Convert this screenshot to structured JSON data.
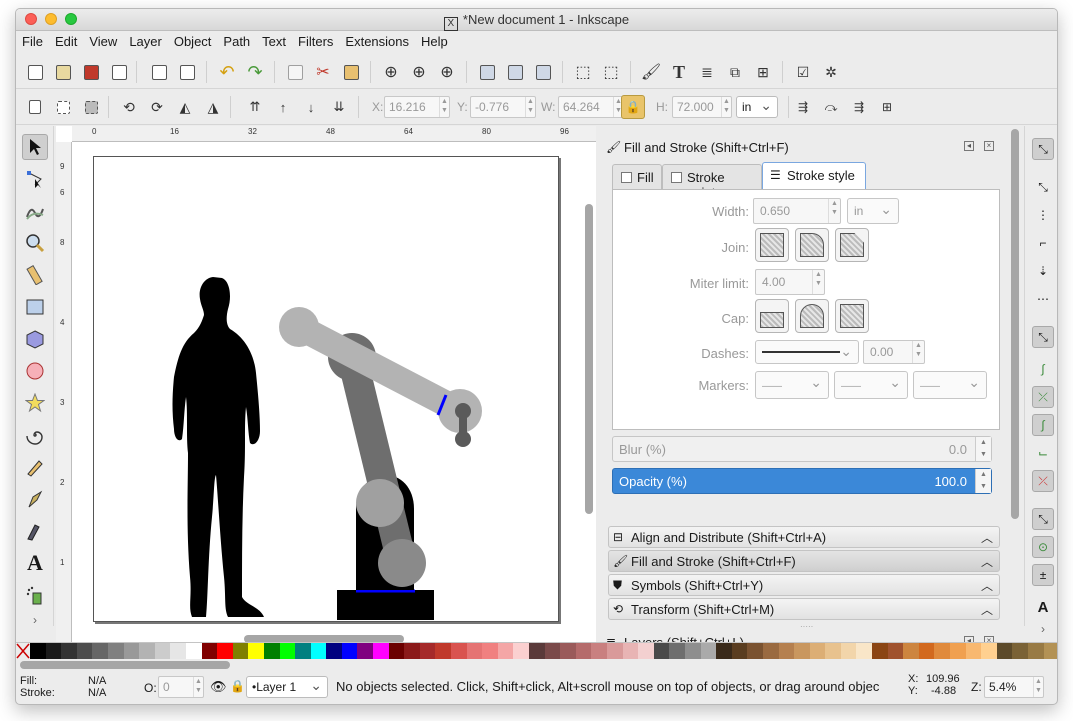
{
  "window": {
    "title": "*New document 1 - Inkscape"
  },
  "menu": [
    "File",
    "Edit",
    "View",
    "Layer",
    "Object",
    "Path",
    "Text",
    "Filters",
    "Extensions",
    "Help"
  ],
  "toolbar": {
    "x_label": "X:",
    "x_value": "16.216",
    "y_label": "Y:",
    "y_value": "-0.776",
    "w_label": "W:",
    "w_value": "64.264",
    "h_label": "H:",
    "h_value": "72.000",
    "unit": "in"
  },
  "rulers": {
    "h": [
      "0",
      "16",
      "32",
      "48",
      "64",
      "80",
      "96"
    ],
    "v": [
      "9",
      "6",
      "8",
      "4",
      "3",
      "2",
      "1"
    ]
  },
  "panel": {
    "title": "Fill and Stroke (Shift+Ctrl+F)",
    "tabs": [
      "Fill",
      "Stroke paint",
      "Stroke style"
    ],
    "width_label": "Width:",
    "width_value": "0.650",
    "width_unit": "in",
    "join_label": "Join:",
    "miter_label": "Miter limit:",
    "miter_value": "4.00",
    "cap_label": "Cap:",
    "dashes_label": "Dashes:",
    "dashes_value": "0.00",
    "markers_label": "Markers:",
    "blur_label": "Blur (%)",
    "blur_value": "0.0",
    "opacity_label": "Opacity (%)",
    "opacity_value": "100.0"
  },
  "dock_items": [
    "Align and Distribute (Shift+Ctrl+A)",
    "Fill and Stroke (Shift+Ctrl+F)",
    "Symbols (Shift+Ctrl+Y)",
    "Transform (Shift+Ctrl+M)"
  ],
  "layers_title": "Layers (Shift+Ctrl+L)",
  "status": {
    "fill_label": "Fill:",
    "fill_value": "N/A",
    "stroke_label": "Stroke:",
    "stroke_value": "N/A",
    "opacity_label": "O:",
    "opacity_value": "0",
    "layer": "•Layer 1",
    "message": "No objects selected. Click, Shift+click, Alt+scroll mouse on top of objects, or drag around objec",
    "cx_label": "X:",
    "cx": "109.96",
    "cy_label": "Y:",
    "cy": "-4.88",
    "zoom_label": "Z:",
    "zoom": "5.4%"
  },
  "colors": {
    "accent": "#3b88d8",
    "selected_stroke": "#0000ff"
  },
  "palette": [
    "#000000",
    "#1a1a1a",
    "#333333",
    "#4d4d4d",
    "#666666",
    "#808080",
    "#999999",
    "#b3b3b3",
    "#cccccc",
    "#e6e6e6",
    "#ffffff",
    "#800000",
    "#ff0000",
    "#808000",
    "#ffff00",
    "#008000",
    "#00ff00",
    "#008080",
    "#00ffff",
    "#000080",
    "#0000ff",
    "#800080",
    "#ff00ff",
    "#6b0000",
    "#8b1a1a",
    "#a52a2a",
    "#c0392b",
    "#d9534f",
    "#e57373",
    "#f08080",
    "#f4a6a6",
    "#fbd0d0",
    "#5a3a3a",
    "#7a4a4a",
    "#9a5a5a",
    "#b56b6b",
    "#c98080",
    "#d99a9a",
    "#e8b4b4",
    "#f3d0d0",
    "#4a4a4a",
    "#6e6e6e",
    "#8e8e8e",
    "#aaaaaa",
    "#3a2a1a",
    "#5a3d20",
    "#7a5230",
    "#9a6a40",
    "#b5804f",
    "#c9975f",
    "#dcae75",
    "#e8c28e",
    "#f2d5aa",
    "#f9e6c8",
    "#8b4513",
    "#a0522d",
    "#cd853f",
    "#d2691e",
    "#e08a3c",
    "#f0a050",
    "#f8b870",
    "#ffd090",
    "#5c4a2a",
    "#7a6236",
    "#987a44",
    "#b39255"
  ]
}
